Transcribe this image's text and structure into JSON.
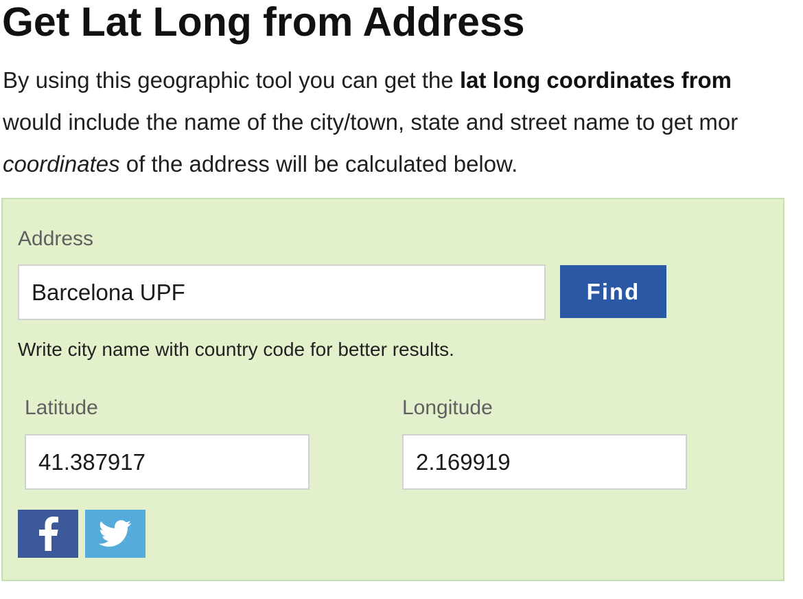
{
  "page": {
    "title": "Get Lat Long from Address",
    "intro": {
      "line1_pre": "By using this geographic tool you can get the ",
      "line1_bold": "lat long coordinates from",
      "line2": "would include the name of the city/town, state and street name to get mor",
      "line3_italic": "coordinates",
      "line3_rest": " of the address will be calculated below."
    }
  },
  "form": {
    "address_label": "Address",
    "address_value": "Barcelona UPF",
    "find_label": "Find",
    "hint": "Write city name with country code for better results.",
    "latitude_label": "Latitude",
    "latitude_value": "41.387917",
    "longitude_label": "Longitude",
    "longitude_value": "2.169919"
  },
  "share": {
    "facebook_icon": "facebook-icon",
    "twitter_icon": "twitter-icon",
    "facebook_color": "#3b5998",
    "twitter_color": "#55acdb"
  },
  "colors": {
    "panel_background": "#e2f1cb",
    "button_blue": "#2b58a4"
  }
}
